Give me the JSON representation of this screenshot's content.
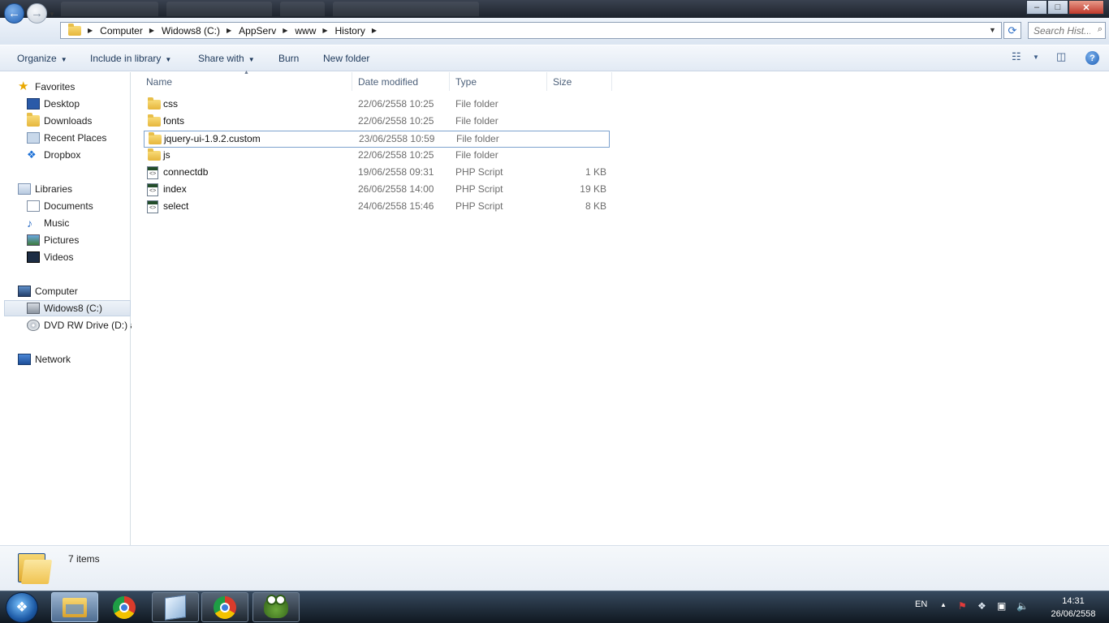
{
  "window": {
    "controls": {
      "minimize": "–",
      "maximize": "□",
      "close": "✕"
    }
  },
  "address": {
    "breadcrumbs": [
      "Computer",
      "Widows8 (C:)",
      "AppServ",
      "www",
      "History"
    ],
    "search_placeholder": "Search Hist..."
  },
  "toolbar": {
    "organize": "Organize",
    "include_in_library": "Include in library",
    "share_with": "Share with",
    "burn": "Burn",
    "new_folder": "New folder",
    "help": "?"
  },
  "sidebar": {
    "favorites": {
      "label": "Favorites",
      "items": [
        {
          "label": "Desktop",
          "icon": "desktop-icon"
        },
        {
          "label": "Downloads",
          "icon": "folder-icon"
        },
        {
          "label": "Recent Places",
          "icon": "recent-places-icon"
        },
        {
          "label": "Dropbox",
          "icon": "dropbox-icon"
        }
      ]
    },
    "libraries": {
      "label": "Libraries",
      "items": [
        {
          "label": "Documents",
          "icon": "documents-icon"
        },
        {
          "label": "Music",
          "icon": "music-icon"
        },
        {
          "label": "Pictures",
          "icon": "pictures-icon"
        },
        {
          "label": "Videos",
          "icon": "videos-icon"
        }
      ]
    },
    "computer": {
      "label": "Computer",
      "items": [
        {
          "label": "Widows8 (C:)",
          "icon": "drive-icon",
          "selected": true
        },
        {
          "label": "DVD RW Drive (D:) a",
          "icon": "dvd-drive-icon"
        }
      ]
    },
    "network": {
      "label": "Network"
    }
  },
  "columns": {
    "name": "Name",
    "date": "Date modified",
    "type": "Type",
    "size": "Size"
  },
  "files": [
    {
      "name": "css",
      "date": "22/06/2558 10:25",
      "type": "File folder",
      "size": "",
      "kind": "folder"
    },
    {
      "name": "fonts",
      "date": "22/06/2558 10:25",
      "type": "File folder",
      "size": "",
      "kind": "folder"
    },
    {
      "name": "jquery-ui-1.9.2.custom",
      "date": "23/06/2558 10:59",
      "type": "File folder",
      "size": "",
      "kind": "folder",
      "focused": true
    },
    {
      "name": "js",
      "date": "22/06/2558 10:25",
      "type": "File folder",
      "size": "",
      "kind": "folder"
    },
    {
      "name": "connectdb",
      "date": "19/06/2558 09:31",
      "type": "PHP Script",
      "size": "1 KB",
      "kind": "php"
    },
    {
      "name": "index",
      "date": "26/06/2558 14:00",
      "type": "PHP Script",
      "size": "19 KB",
      "kind": "php"
    },
    {
      "name": "select",
      "date": "24/06/2558 15:46",
      "type": "PHP Script",
      "size": "8 KB",
      "kind": "php"
    }
  ],
  "details": {
    "item_count": "7 items"
  },
  "taskbar": {
    "apps": [
      "windows-explorer",
      "chrome",
      "virtualbox-cube",
      "chrome",
      "frog-app"
    ],
    "language": "EN",
    "time": "14:31",
    "date": "26/06/2558"
  }
}
